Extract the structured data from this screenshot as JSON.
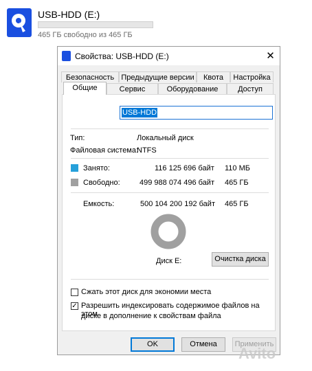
{
  "drive_tile": {
    "name": "USB-HDD (E:)",
    "free_text": "465 ГБ свободно из 465 ГБ",
    "used_fraction": 0.0
  },
  "dialog": {
    "title": "Свойства: USB-HDD (E:)",
    "close_glyph": "✕",
    "tabs_row1": [
      "Безопасность",
      "Предыдущие версии",
      "Квота",
      "Настройка"
    ],
    "tabs_row2": [
      "Общие",
      "Сервис",
      "Оборудование",
      "Доступ"
    ],
    "active_tab": "Общие",
    "volume_name": "USB-HDD",
    "type_label": "Тип:",
    "type_value": "Локальный диск",
    "fs_label": "Файловая система:",
    "fs_value": "NTFS",
    "used": {
      "label": "Занято:",
      "bytes": "116 125 696 байт",
      "short": "110 МБ",
      "color": "#26a0da"
    },
    "free": {
      "label": "Свободно:",
      "bytes": "499 988 074 496 байт",
      "short": "465 ГБ",
      "color": "#a0a0a0"
    },
    "capacity": {
      "label": "Емкость:",
      "bytes": "500 104 200 192 байт",
      "short": "465 ГБ"
    },
    "disk_label": "Диск E:",
    "cleanup_button": "Очистка диска",
    "compress_label": "Сжать этот диск для экономии места",
    "compress_checked": false,
    "index_label_line1": "Разрешить индексировать содержимое файлов на этом",
    "index_label_line2": "диске в дополнение к свойствам файла",
    "index_checked": true,
    "ok_button": "OK",
    "cancel_button": "Отмена",
    "apply_button": "Применить"
  },
  "watermark": "Avito"
}
